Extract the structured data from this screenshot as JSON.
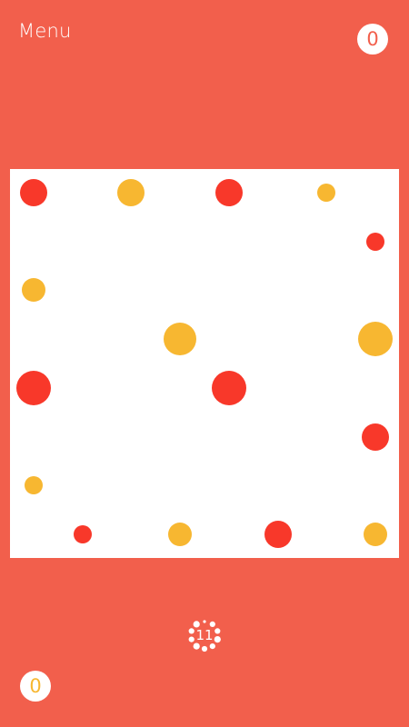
{
  "header": {
    "menu_label": "Menu",
    "player_top_score": "0"
  },
  "footer": {
    "player_bottom_score": "0",
    "timer_value": "11"
  },
  "colors": {
    "background": "#F25F4C",
    "red_dot": "#F8382A",
    "yellow_dot": "#F7B731",
    "board": "#FFFFFF"
  },
  "board": {
    "grid_size": 8,
    "dots": [
      {
        "row": 0,
        "col": 0,
        "color": "red",
        "size": "large"
      },
      {
        "row": 0,
        "col": 2,
        "color": "yellow",
        "size": "large"
      },
      {
        "row": 0,
        "col": 4,
        "color": "red",
        "size": "large"
      },
      {
        "row": 0,
        "col": 6,
        "color": "yellow",
        "size": "small"
      },
      {
        "row": 1,
        "col": 7,
        "color": "red",
        "size": "small"
      },
      {
        "row": 2,
        "col": 0,
        "color": "yellow",
        "size": "medium"
      },
      {
        "row": 3,
        "col": 3,
        "color": "yellow",
        "size": "xlarge"
      },
      {
        "row": 3,
        "col": 7,
        "color": "yellow",
        "size": "xxlarge"
      },
      {
        "row": 4,
        "col": 0,
        "color": "red",
        "size": "xxlarge"
      },
      {
        "row": 4,
        "col": 4,
        "color": "red",
        "size": "xxlarge"
      },
      {
        "row": 5,
        "col": 7,
        "color": "red",
        "size": "large"
      },
      {
        "row": 6,
        "col": 0,
        "color": "yellow",
        "size": "small"
      },
      {
        "row": 7,
        "col": 1,
        "color": "red",
        "size": "small"
      },
      {
        "row": 7,
        "col": 3,
        "color": "yellow",
        "size": "medium"
      },
      {
        "row": 7,
        "col": 5,
        "color": "red",
        "size": "large"
      },
      {
        "row": 7,
        "col": 7,
        "color": "yellow",
        "size": "medium"
      }
    ]
  }
}
